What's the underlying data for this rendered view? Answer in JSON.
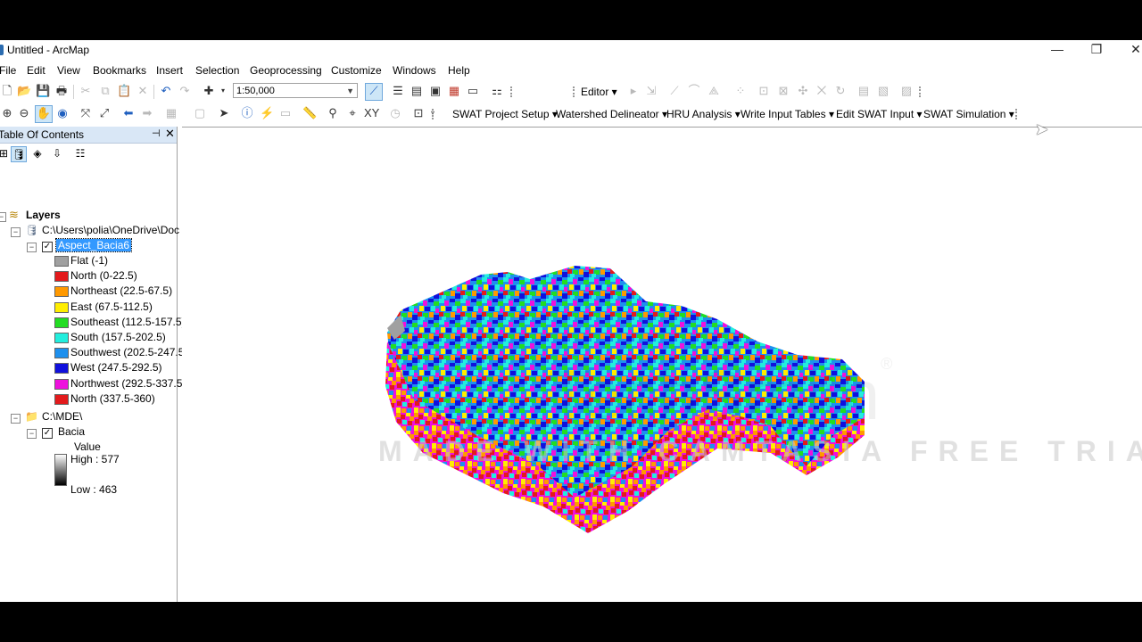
{
  "window": {
    "title": "Untitled - ArcMap",
    "minimize": "—",
    "restore": "❐",
    "close": "✕"
  },
  "menu": [
    "File",
    "Edit",
    "View",
    "Bookmarks",
    "Insert",
    "Selection",
    "Geoprocessing",
    "Customize",
    "Windows",
    "Help"
  ],
  "toolbar": {
    "scale_value": "1:50,000",
    "editor_label": "Editor ▾"
  },
  "swat_menu": [
    "SWAT Project Setup ▾",
    "Watershed Delineator ▾",
    "HRU Analysis ▾",
    "Write Input Tables ▾",
    "Edit SWAT Input ▾",
    "SWAT Simulation ▾"
  ],
  "toc": {
    "header": "Table Of Contents",
    "pin": "⊣",
    "close": "✕",
    "root_label": "Layers",
    "groups": [
      {
        "path": "C:\\Users\\polia\\OneDrive\\Doc",
        "layer": "Aspect_Bacia6",
        "classes": [
          {
            "label": "Flat (-1)",
            "color": "#a0a0a0"
          },
          {
            "label": "North (0-22.5)",
            "color": "#e31a1c"
          },
          {
            "label": "Northeast (22.5-67.5)",
            "color": "#ff9900"
          },
          {
            "label": "East (67.5-112.5)",
            "color": "#ffee00"
          },
          {
            "label": "Southeast (112.5-157.5)",
            "color": "#22dd22"
          },
          {
            "label": "South (157.5-202.5)",
            "color": "#22eedd"
          },
          {
            "label": "Southwest (202.5-247.5",
            "color": "#1e90ee"
          },
          {
            "label": "West (247.5-292.5)",
            "color": "#1010dd"
          },
          {
            "label": "Northwest (292.5-337.5",
            "color": "#ee11dd"
          },
          {
            "label": "North (337.5-360)",
            "color": "#e31a1c"
          }
        ]
      },
      {
        "path": "C:\\MDE\\",
        "layer": "Bacia",
        "value_label": "Value",
        "high": "High : 577",
        "low": "Low : 463"
      }
    ]
  },
  "map": {
    "watermark_brand": "TechSmith",
    "watermark_registered": "®",
    "watermark_text": "MADE WITH CAMTASIA FREE TRIAL"
  }
}
